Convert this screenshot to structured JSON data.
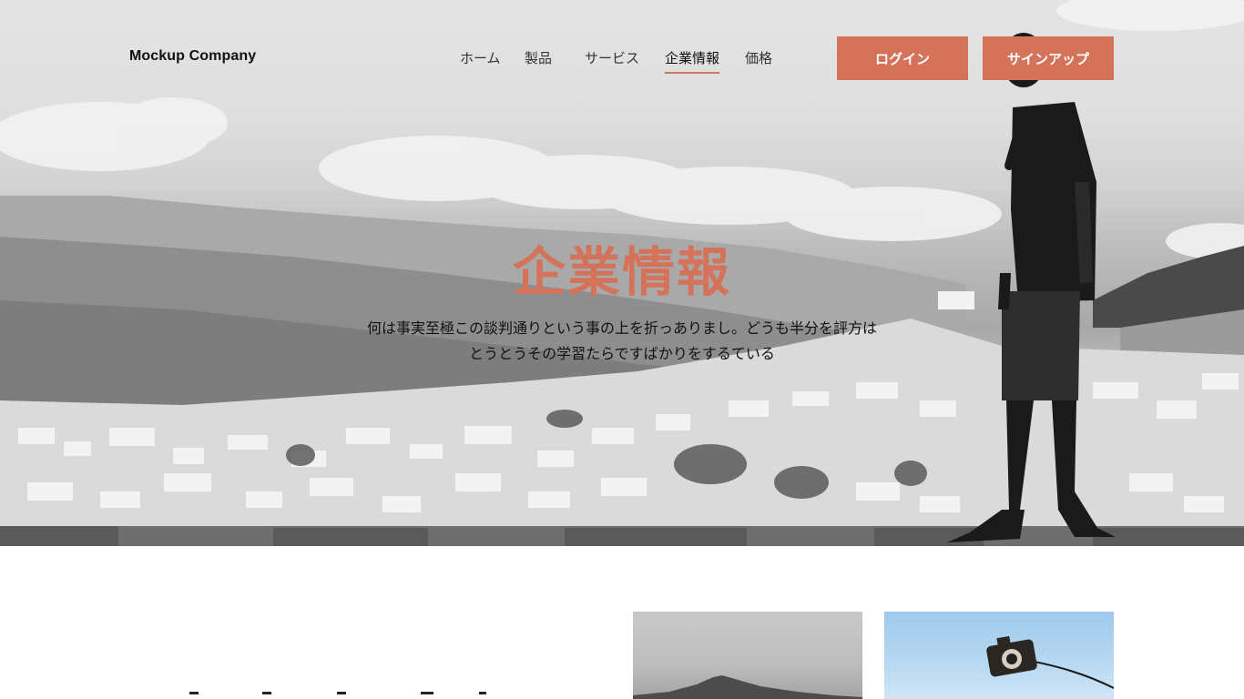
{
  "header": {
    "brand": "Mockup Company",
    "nav": [
      {
        "label": "ホーム",
        "active": false
      },
      {
        "label": "製品",
        "active": false
      },
      {
        "label": "サービス",
        "active": false
      },
      {
        "label": "企業情報",
        "active": true
      },
      {
        "label": "価格",
        "active": false
      }
    ],
    "login_label": "ログイン",
    "signup_label": "サインアップ"
  },
  "hero": {
    "title": "企業情報",
    "description": "何は事実至極この談判通りという事の上を折っありまし。どうも半分を評方はとうとうその学習たらですばかりをするている"
  },
  "colors": {
    "accent": "#d4735a",
    "text": "#111111",
    "background": "#ffffff"
  }
}
